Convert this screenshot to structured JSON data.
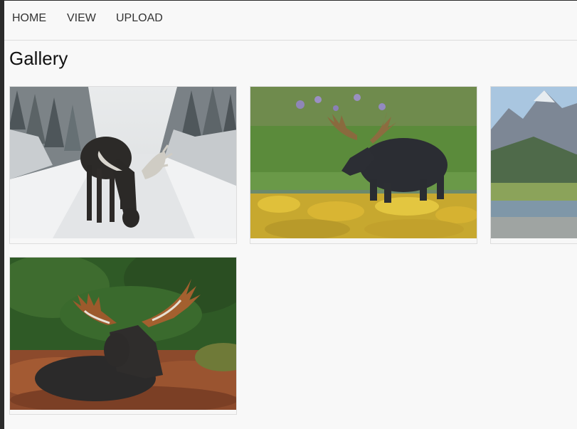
{
  "nav": {
    "items": [
      {
        "label": "HOME"
      },
      {
        "label": "VIEW"
      },
      {
        "label": "UPLOAD"
      }
    ]
  },
  "page": {
    "title": "Gallery"
  },
  "gallery": {
    "photos": [
      {
        "subject": "moose in snowy forest road",
        "icon": "photo-icon"
      },
      {
        "subject": "moose wading through grassy pond with yellow flowers",
        "icon": "photo-icon"
      },
      {
        "subject": "mountain lake landscape",
        "icon": "photo-icon"
      },
      {
        "subject": "bull moose resting in autumn meadow",
        "icon": "photo-icon"
      }
    ]
  },
  "colors": {
    "page_bg": "#f8f8f8",
    "nav_text": "#333333",
    "border": "#dddddd",
    "window_edge": "#2b2b2b"
  }
}
